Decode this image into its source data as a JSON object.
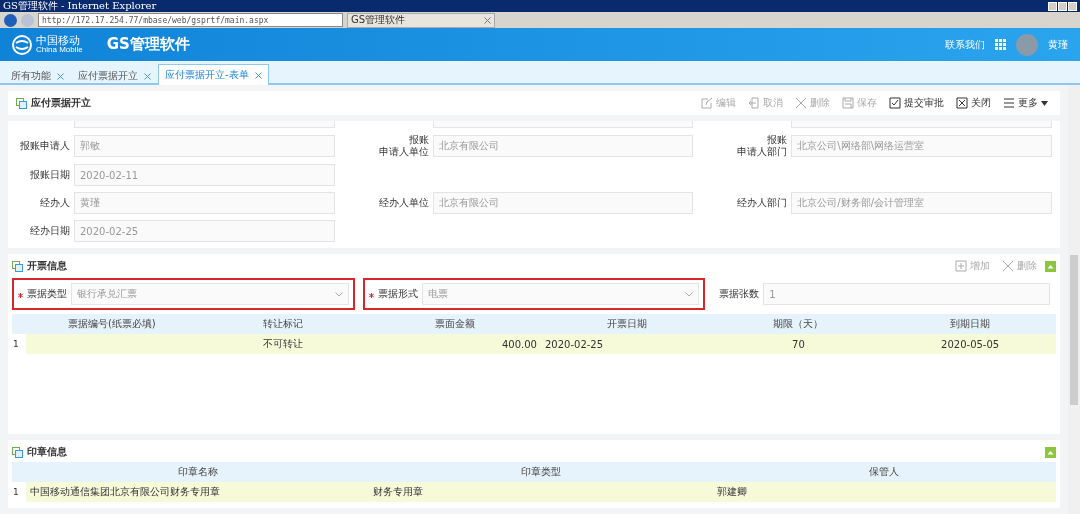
{
  "browser": {
    "title": "GS管理软件 - Internet Explorer",
    "url": "http://172.17.254.77/mbase/web/gsprtf/main.aspx",
    "tab": "GS管理软件"
  },
  "header": {
    "logo_cn": "中国移动",
    "logo_en": "China Mobile",
    "app_title": "GS管理软件",
    "contact": "联系我们",
    "user": "黄瑾"
  },
  "tabs": [
    {
      "label": "所有功能",
      "selected": false
    },
    {
      "label": "应付票据开立",
      "selected": false
    },
    {
      "label": "应付票据开立-表单",
      "selected": true
    }
  ],
  "page": {
    "title": "应付票据开立",
    "actions": [
      {
        "kind": "edit",
        "label": "编辑",
        "disabled": true
      },
      {
        "kind": "cancel",
        "label": "取消",
        "disabled": true
      },
      {
        "kind": "delete",
        "label": "删除",
        "disabled": true
      },
      {
        "kind": "save",
        "label": "保存",
        "disabled": true
      },
      {
        "kind": "submit",
        "label": "提交审批",
        "disabled": false
      },
      {
        "kind": "close",
        "label": "关闭",
        "disabled": false
      },
      {
        "kind": "more",
        "label": "更多",
        "disabled": false
      }
    ]
  },
  "form": {
    "rows": [
      [
        {
          "label": "报账申请人",
          "value": "郭敏"
        },
        {
          "label": [
            "报账",
            "申请人单位"
          ],
          "value": "北京有限公司"
        },
        {
          "label": [
            "报账",
            "申请人部门"
          ],
          "value": "北京公司\\网络部\\网络运营室"
        }
      ],
      [
        {
          "label": "报账日期",
          "value": "2020-02-11"
        },
        null,
        null
      ],
      [
        {
          "label": "经办人",
          "value": "黄瑾"
        },
        {
          "label": "经办人单位",
          "value": "北京有限公司"
        },
        {
          "label": "经办人部门",
          "value": "北京公司/财务部/会计管理室"
        }
      ],
      [
        {
          "label": "经办日期",
          "value": "2020-02-25"
        },
        null,
        null
      ]
    ]
  },
  "invoice": {
    "title": "开票信息",
    "actions": [
      {
        "kind": "add",
        "label": "增加",
        "disabled": true
      },
      {
        "kind": "delete",
        "label": "删除",
        "disabled": true
      }
    ],
    "fields": [
      {
        "kind": "select",
        "label": "票据类型",
        "value": "银行承兑汇票",
        "required": true,
        "highlighted": true
      },
      {
        "kind": "select",
        "label": "票据形式",
        "value": "电票",
        "required": true,
        "highlighted": true
      },
      {
        "kind": "input",
        "label": "票据张数",
        "value": "1",
        "required": false,
        "highlighted": false
      }
    ],
    "columns": [
      "票据编号(纸票必填)",
      "转让标记",
      "票面金额",
      "开票日期",
      "期限（天）",
      "到期日期"
    ],
    "rows": [
      {
        "index": "1",
        "cells": [
          "",
          "不可转让",
          "400.00",
          "2020-02-25",
          "70",
          "2020-05-05"
        ],
        "selected": true
      }
    ]
  },
  "seal": {
    "title": "印章信息",
    "columns": [
      "印章名称",
      "印章类型",
      "保管人"
    ],
    "rows": [
      {
        "index": "1",
        "cells": [
          "中国移动通信集团北京有限公司财务专用章",
          "财务专用章",
          "郭建卿"
        ],
        "selected": true
      }
    ]
  }
}
